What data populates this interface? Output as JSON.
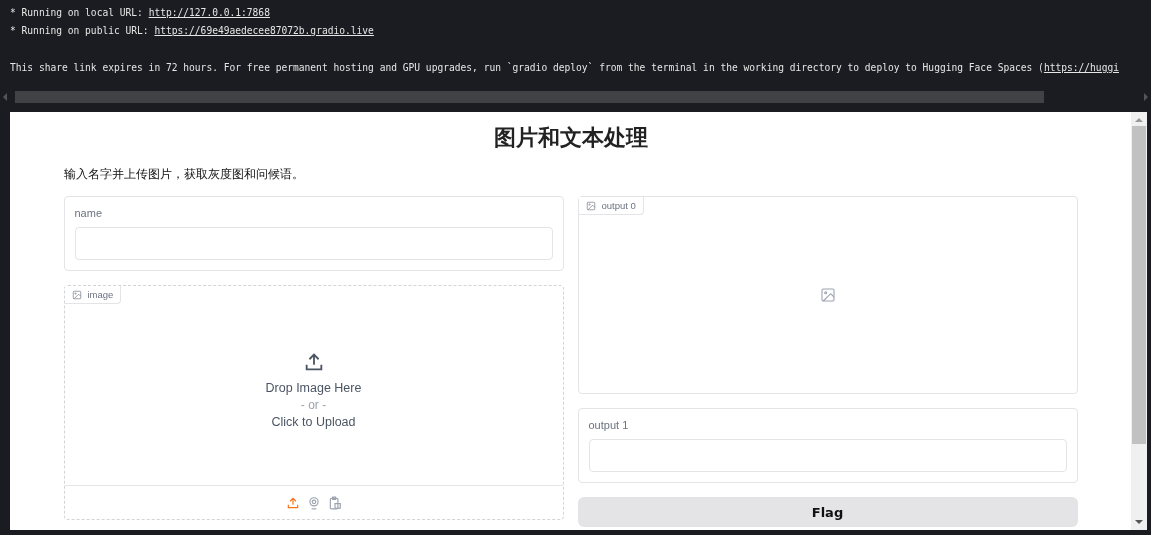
{
  "terminal": {
    "lines": [
      {
        "text": "* Running on local URL:  ",
        "link": "http://127.0.0.1:7868"
      },
      {
        "text": "* Running on public URL: ",
        "link": "https://69e49aedecee87072b.gradio.live"
      },
      {
        "text": "This share link expires in 72 hours. For free permanent hosting and GPU upgrades, run `gradio deploy` from the terminal in the working directory to deploy to Hugging Face Spaces (",
        "link": "https://huggi"
      }
    ]
  },
  "app": {
    "title": "图片和文本处理",
    "description": "输入名字并上传图片，获取灰度图和问候语。",
    "name_input": {
      "label": "name"
    },
    "image_input": {
      "label": "image",
      "drop_text": "Drop Image Here",
      "or_text": "- or -",
      "click_text": "Click to Upload",
      "sources": [
        {
          "kind": "upload",
          "selected": true
        },
        {
          "kind": "webcam",
          "selected": false
        },
        {
          "kind": "clipboard",
          "selected": false
        }
      ]
    },
    "output_image": {
      "label": "output 0"
    },
    "output_text": {
      "label": "output 1"
    },
    "flag_button": "Flag"
  }
}
